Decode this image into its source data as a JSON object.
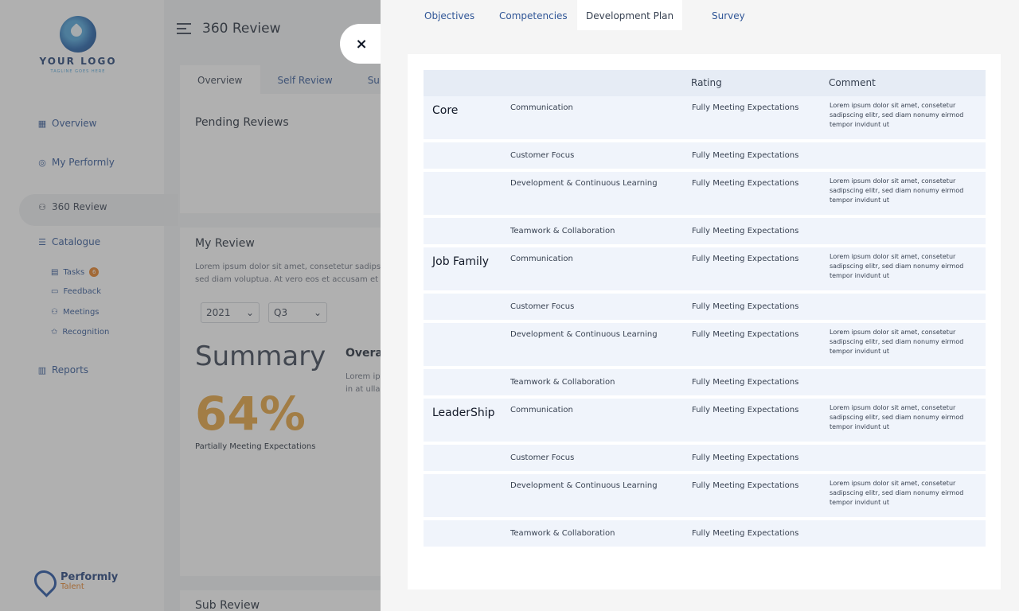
{
  "sidebar": {
    "logo_text": "YOUR LOGO",
    "logo_tagline": "TAGLINE GOES HERE",
    "items": [
      {
        "label": "Overview",
        "icon": "grid-icon"
      },
      {
        "label": "My Performly",
        "icon": "location-pin-icon"
      },
      {
        "label": "360 Review",
        "icon": "people-icon"
      },
      {
        "label": "Catalogue",
        "icon": "list-icon"
      }
    ],
    "sub_items": [
      {
        "label": "Tasks",
        "icon": "clipboard-icon",
        "badge": "6"
      },
      {
        "label": "Feedback",
        "icon": "message-icon"
      },
      {
        "label": "Meetings",
        "icon": "group-icon"
      },
      {
        "label": "Recognition",
        "icon": "award-icon"
      }
    ],
    "reports_label": "Reports",
    "brand_name": "Performly",
    "brand_sub": "Talent"
  },
  "main": {
    "title": "360 Review",
    "tabs": [
      "Overview",
      "Self Review",
      "Sub"
    ],
    "pending_title": "Pending Reviews",
    "my_review_title": "My Review",
    "my_review_text_1": "Lorem ipsum dolor sit amet, consetetur sadipsc",
    "my_review_text_2": "sed diam voluptua. At vero eos et accusam et j",
    "year_select": "2021",
    "quarter_select": "Q3",
    "summary_title": "Summary",
    "summary_percent": "64%",
    "summary_label": "Partially Meeting Expectations",
    "overall_title": "Overal",
    "overall_text_1": "Lorem ips",
    "overall_text_2": "in at ulla",
    "sub_review_title": "Sub Review"
  },
  "panel": {
    "close_label": "×",
    "tabs": [
      "Objectives",
      "Competencies",
      "Development Plan",
      "Survey"
    ],
    "active_tab": 2,
    "table": {
      "headers": [
        "",
        "",
        "Rating",
        "Comment"
      ],
      "groups": [
        {
          "name": "Core",
          "rows": [
            {
              "competency": "Communication",
              "rating": "Fully Meeting Expectations",
              "comment": "Lorem ipsum dolor sit amet, consetetur sadipscing elitr, sed diam nonumy eirmod tempor invidunt ut"
            },
            {
              "competency": "Customer Focus",
              "rating": "Fully Meeting Expectations",
              "comment": ""
            },
            {
              "competency": "Development & Continuous Learning",
              "rating": "Fully Meeting Expectations",
              "comment": "Lorem ipsum dolor sit amet, consetetur sadipscing elitr, sed diam nonumy eirmod tempor invidunt ut"
            },
            {
              "competency": "Teamwork & Collaboration",
              "rating": "Fully Meeting Expectations",
              "comment": ""
            }
          ]
        },
        {
          "name": "Job Family",
          "rows": [
            {
              "competency": "Communication",
              "rating": "Fully Meeting Expectations",
              "comment": "Lorem ipsum dolor sit amet, consetetur sadipscing elitr, sed diam nonumy eirmod tempor invidunt ut"
            },
            {
              "competency": "Customer Focus",
              "rating": "Fully Meeting Expectations",
              "comment": ""
            },
            {
              "competency": "Development & Continuous Learning",
              "rating": "Fully Meeting Expectations",
              "comment": "Lorem ipsum dolor sit amet, consetetur sadipscing elitr, sed diam nonumy eirmod tempor invidunt ut"
            },
            {
              "competency": "Teamwork & Collaboration",
              "rating": "Fully Meeting Expectations",
              "comment": ""
            }
          ]
        },
        {
          "name": "LeaderShip",
          "rows": [
            {
              "competency": "Communication",
              "rating": "Fully Meeting Expectations",
              "comment": "Lorem ipsum dolor sit amet, consetetur sadipscing elitr, sed diam nonumy eirmod tempor invidunt ut"
            },
            {
              "competency": "Customer Focus",
              "rating": "Fully Meeting Expectations",
              "comment": ""
            },
            {
              "competency": "Development & Continuous Learning",
              "rating": "Fully Meeting Expectations",
              "comment": "Lorem ipsum dolor sit amet, consetetur sadipscing elitr, sed diam nonumy eirmod tempor invidunt ut"
            },
            {
              "competency": "Teamwork & Collaboration",
              "rating": "Fully Meeting Expectations",
              "comment": ""
            }
          ]
        }
      ]
    }
  },
  "colors": {
    "accent": "#2f5596",
    "percent": "#e6a23c",
    "badge": "#e67e22",
    "row_bg": "#f0f4fb",
    "header_bg": "#e6ecf5"
  }
}
